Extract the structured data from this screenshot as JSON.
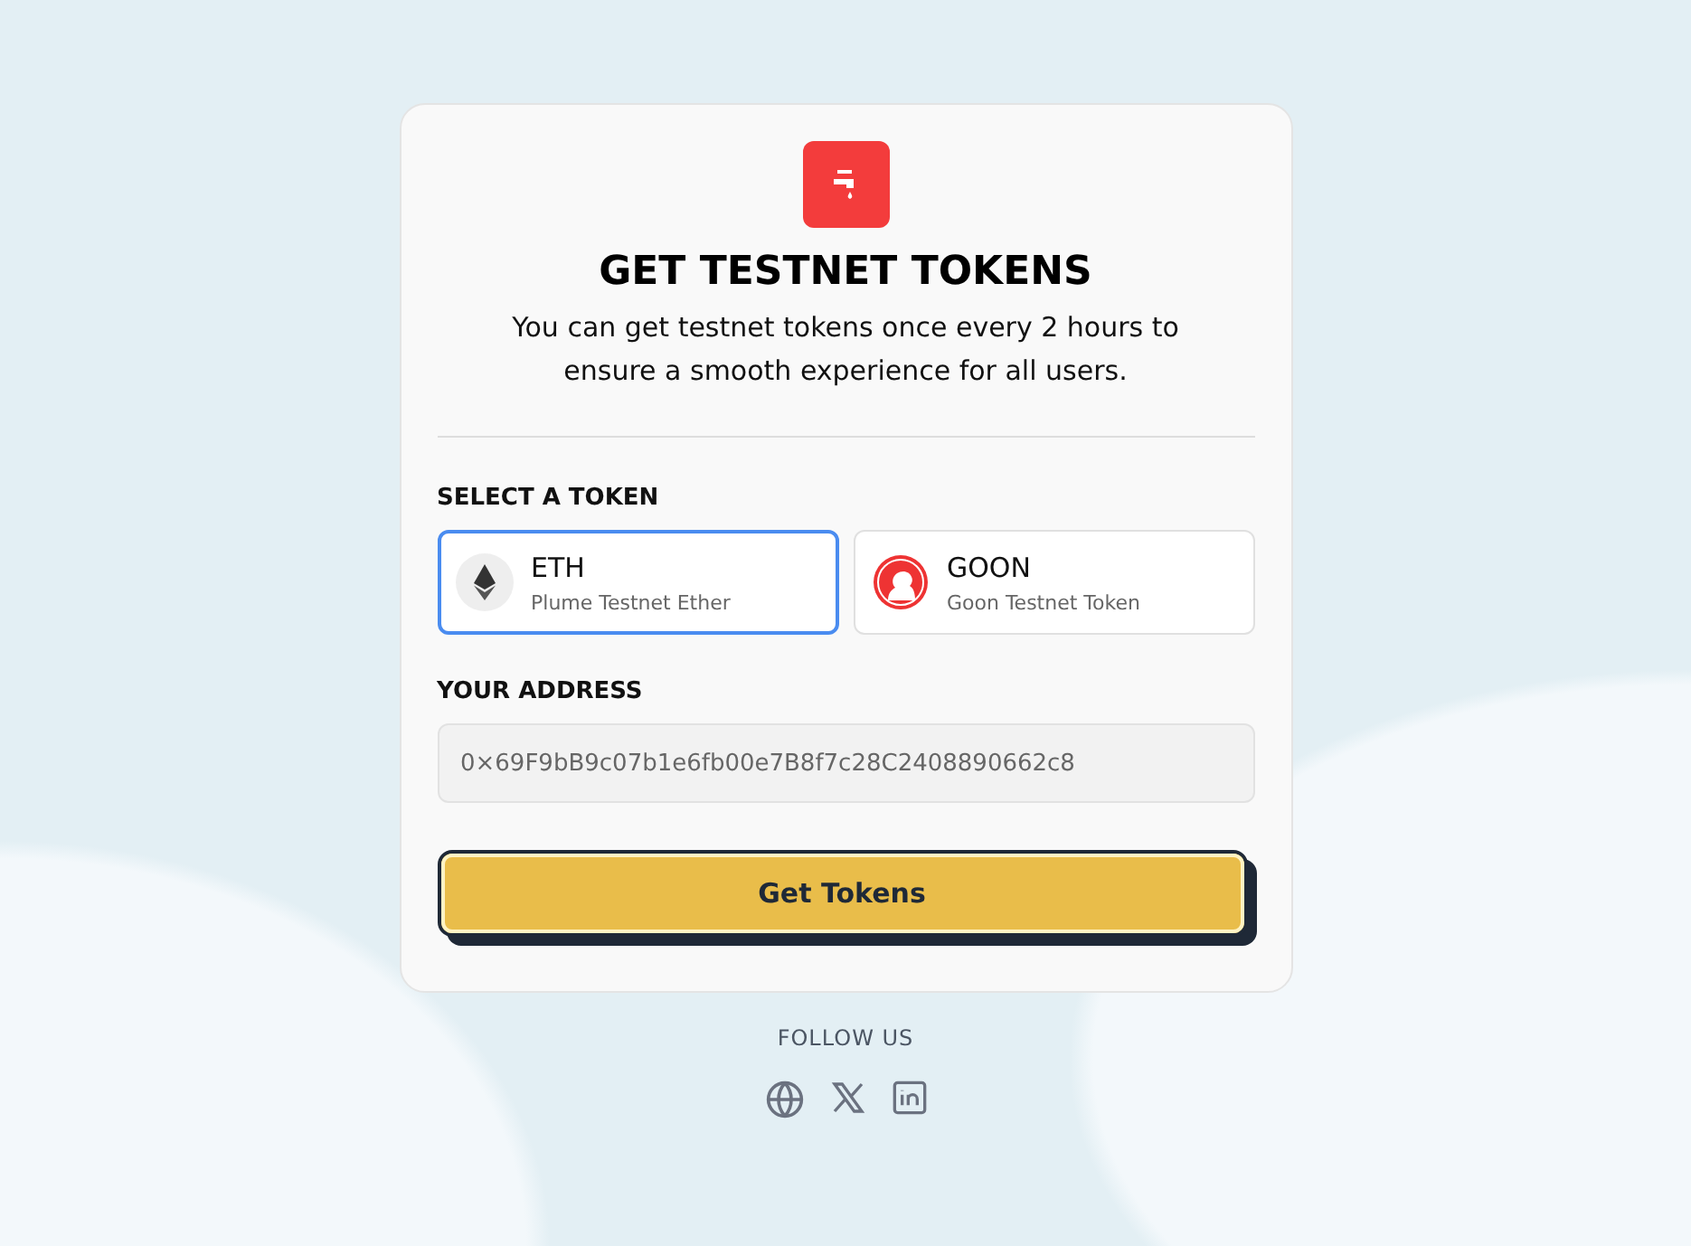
{
  "card": {
    "title": "GET TESTNET TOKENS",
    "subtitle": "You can get testnet tokens once every 2 hours to ensure a smooth experience for all users.",
    "token_label": "SELECT A TOKEN",
    "tokens": [
      {
        "kind": "eth",
        "symbol": "ETH",
        "name": "Plume Testnet Ether",
        "selected": true
      },
      {
        "kind": "goon",
        "symbol": "GOON",
        "name": "Goon Testnet Token",
        "selected": false
      }
    ],
    "address_label": "YOUR ADDRESS",
    "address": "0×69F9bB9c07b1e6fb00e7B8f7c28C2408890662c8",
    "button": "Get Tokens"
  },
  "footer": {
    "label": "FOLLOW US",
    "links": [
      {
        "kind": "globe"
      },
      {
        "kind": "x"
      },
      {
        "kind": "linkedin"
      }
    ]
  }
}
